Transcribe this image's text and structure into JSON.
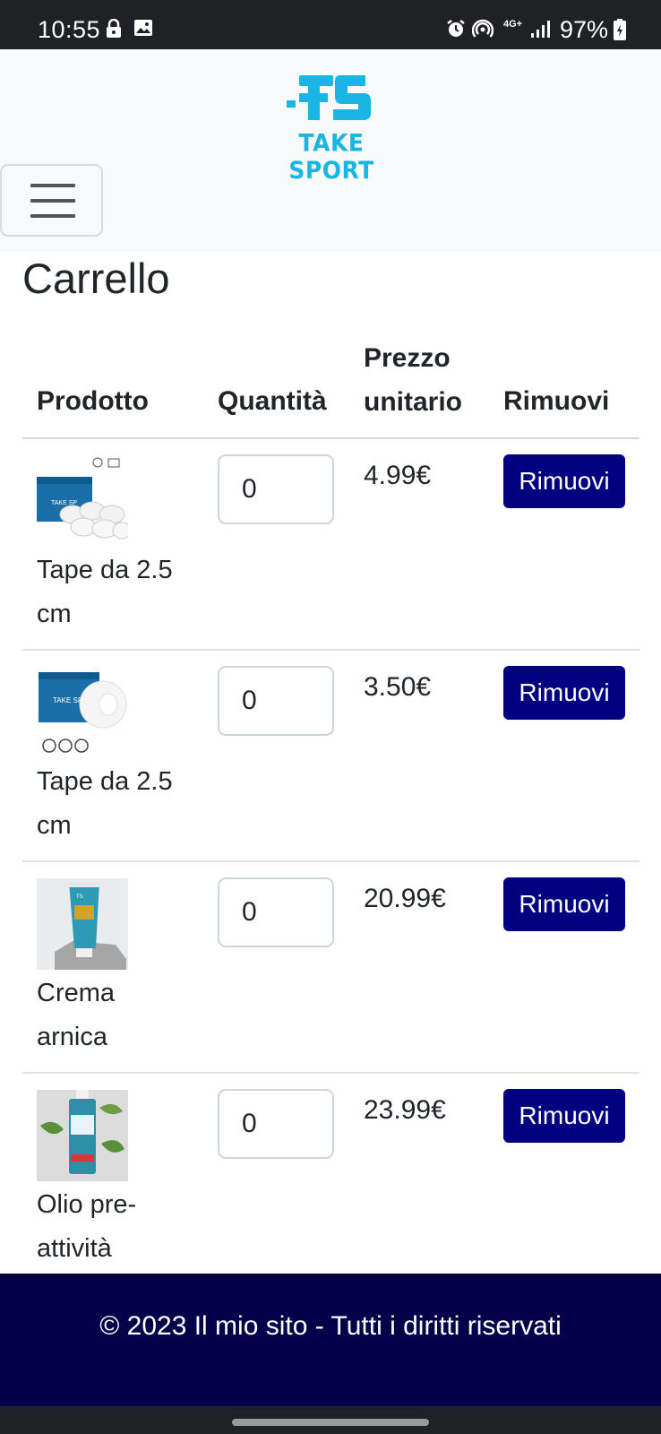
{
  "status_bar": {
    "time": "10:55",
    "network": "4G+",
    "battery": "97%",
    "icons": [
      "lock-icon",
      "image-icon",
      "alarm-icon",
      "hotspot-icon",
      "signal-icon",
      "battery-icon"
    ]
  },
  "navbar": {
    "logo_text": "TAKE SPORT",
    "menu_icon": "hamburger-menu-icon"
  },
  "page": {
    "title": "Carrello"
  },
  "table": {
    "headers": {
      "product": "Prodotto",
      "quantity": "Quantità",
      "unit_price": "Prezzo unitario",
      "remove": "Rimuovi"
    },
    "rows": [
      {
        "name": "Tape da 2.5 cm",
        "quantity": "0",
        "price": "4.99€",
        "remove_label": "Rimuovi"
      },
      {
        "name": "Tape da 2.5 cm",
        "quantity": "0",
        "price": "3.50€",
        "remove_label": "Rimuovi"
      },
      {
        "name": "Crema arnica",
        "quantity": "0",
        "price": "20.99€",
        "remove_label": "Rimuovi"
      },
      {
        "name": "Olio pre-attività",
        "quantity": "0",
        "price": "23.99€",
        "remove_label": "Rimuovi"
      }
    ]
  },
  "footer": {
    "text": "© 2023 Il mio sito - Tutti i diritti riservati"
  },
  "colors": {
    "brand": "#1ab6e3",
    "button": "#000080",
    "footer": "#05004a"
  }
}
